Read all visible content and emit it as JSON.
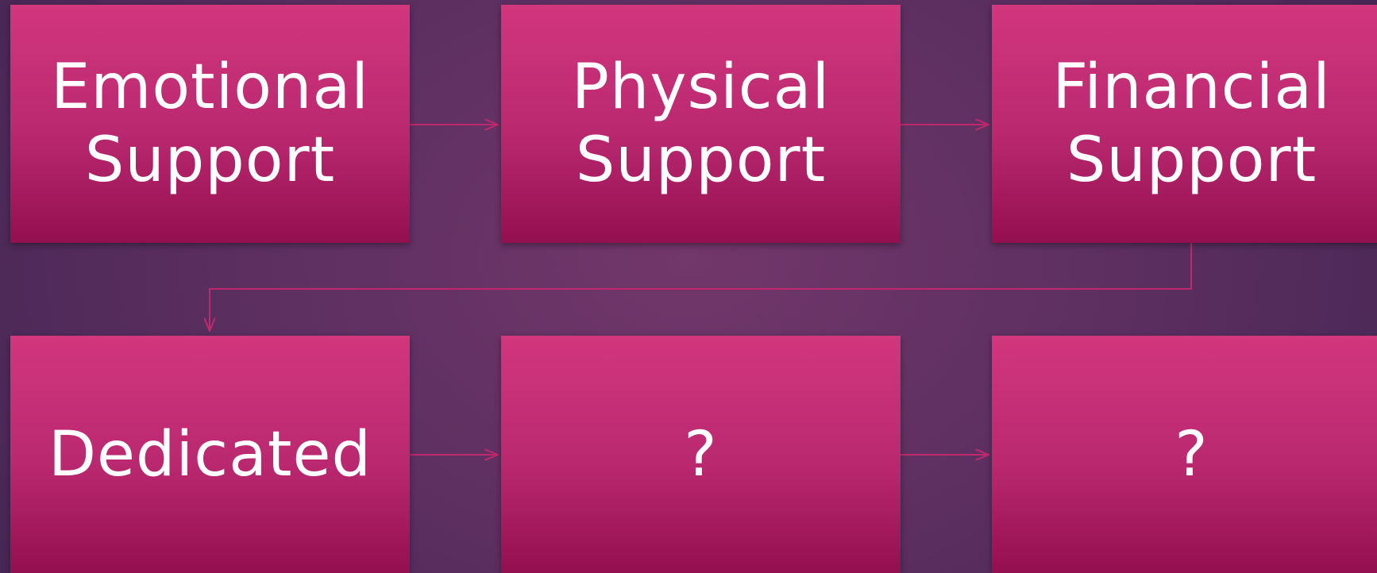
{
  "colors": {
    "background": "#5c2f60",
    "box_top": "#d2367d",
    "box_bottom": "#940f4f",
    "connector": "#c0286e",
    "text": "#ffffff"
  },
  "nodes": [
    {
      "line1": "Emotional",
      "line2": "Support"
    },
    {
      "line1": "Physical",
      "line2": "Support"
    },
    {
      "line1": "Financial",
      "line2": "Support"
    },
    {
      "line1": "Dedicated",
      "line2": ""
    },
    {
      "line1": "?",
      "line2": ""
    },
    {
      "line1": "?",
      "line2": ""
    }
  ]
}
